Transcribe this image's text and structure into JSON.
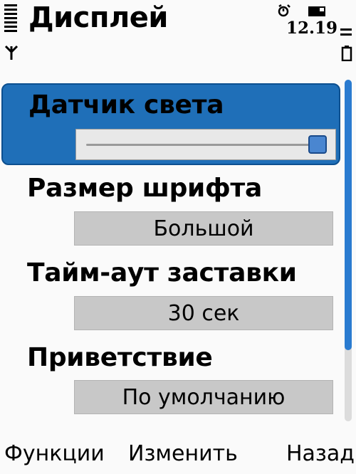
{
  "header": {
    "title": "Дисплей",
    "clock": "12.19",
    "icons": [
      "signal-strength-icon",
      "antenna-icon",
      "alarm-icon",
      "sim-card-icon",
      "battery-level-icon",
      "battery-icon"
    ]
  },
  "settings": {
    "light_sensor": {
      "label": "Датчик света",
      "slider_level": 1.0
    },
    "font_size": {
      "label": "Размер шрифта",
      "value": "Большой"
    },
    "screensaver_timeout": {
      "label": "Тайм-аут заставки",
      "value": "30 сек"
    },
    "welcome_note": {
      "label": "Приветствие",
      "value": "По умолчанию"
    }
  },
  "softkeys": {
    "left": "Функции",
    "middle": "Изменить",
    "right": "Назад"
  },
  "colors": {
    "highlight": "#1f6fb8",
    "scroll_thumb": "#2a7bd0",
    "value_box": "#c8c8c8",
    "background": "#fafafa"
  }
}
